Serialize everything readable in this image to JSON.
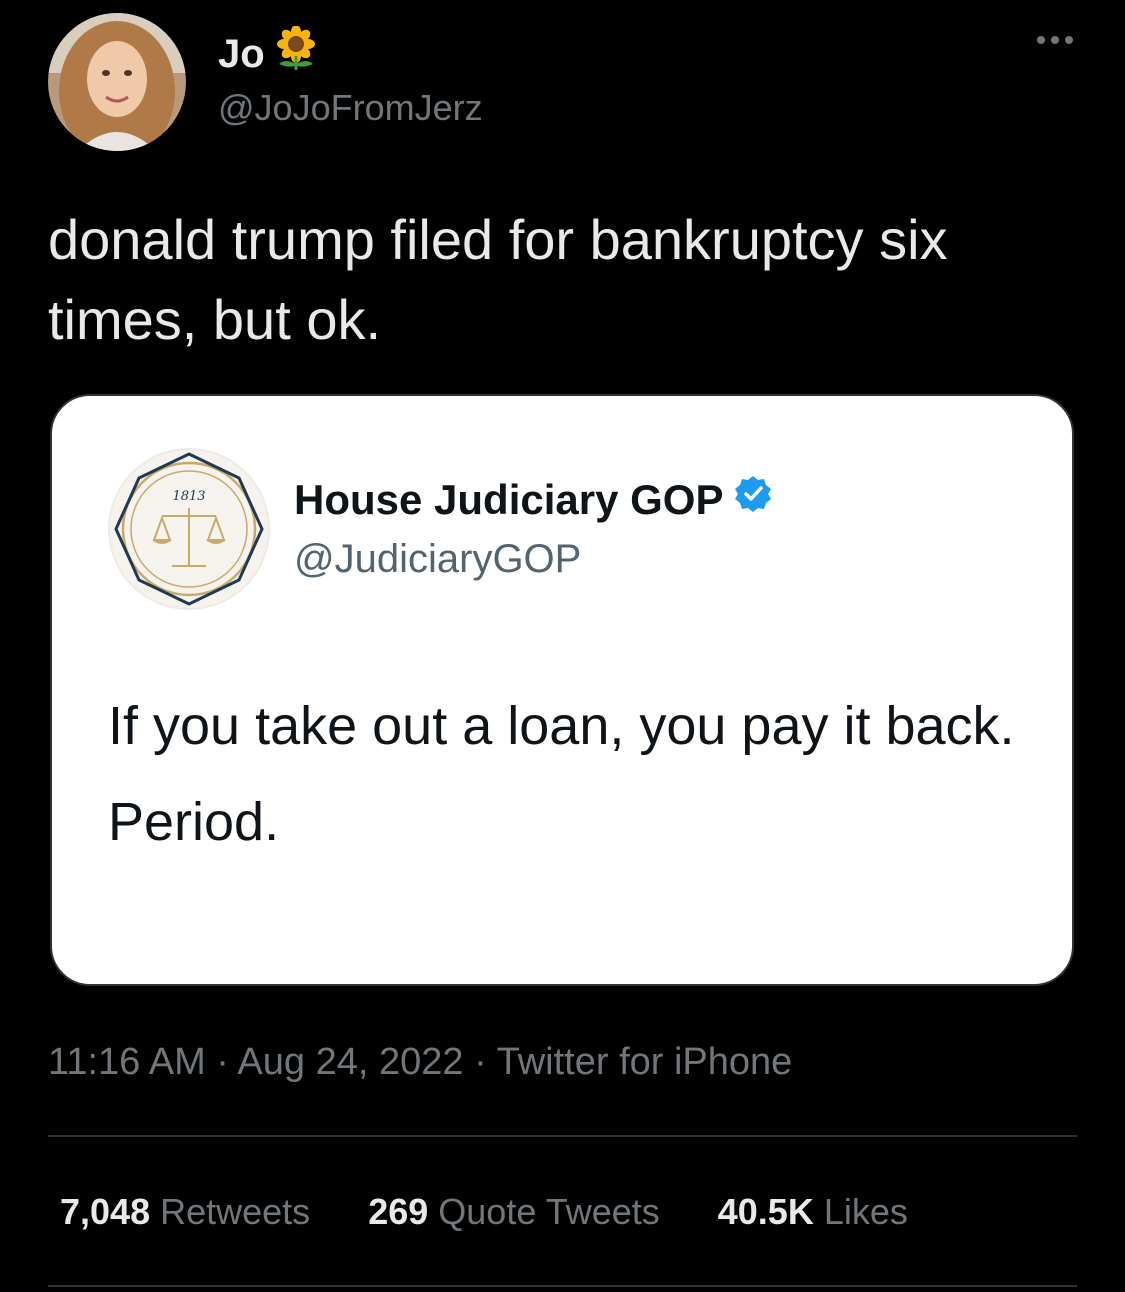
{
  "author": {
    "display_name": "Jo",
    "name_emoji": "sunflower-icon",
    "handle": "@JoJoFromJerz"
  },
  "tweet": {
    "text": "donald trump filed for bankruptcy six times, but ok."
  },
  "quoted": {
    "display_name": "House Judiciary GOP",
    "handle": "@JudiciaryGOP",
    "verified": true,
    "logo_year": "1813",
    "paragraphs": [
      "If you take out a loan, you pay it back.",
      "Period."
    ]
  },
  "meta": {
    "time": "11:16 AM",
    "date": "Aug 24, 2022",
    "source": "Twitter for iPhone",
    "separator": "·"
  },
  "stats": {
    "retweets_count": "7,048",
    "retweets_label": "Retweets",
    "quotes_count": "269",
    "quotes_label": "Quote Tweets",
    "likes_count": "40.5K",
    "likes_label": "Likes"
  },
  "colors": {
    "background": "#000000",
    "text": "#e7e9ea",
    "secondary": "#71767b",
    "verified": "#1d9bf0",
    "seal_gold": "#c8a96a",
    "seal_navy": "#1f3a55"
  }
}
